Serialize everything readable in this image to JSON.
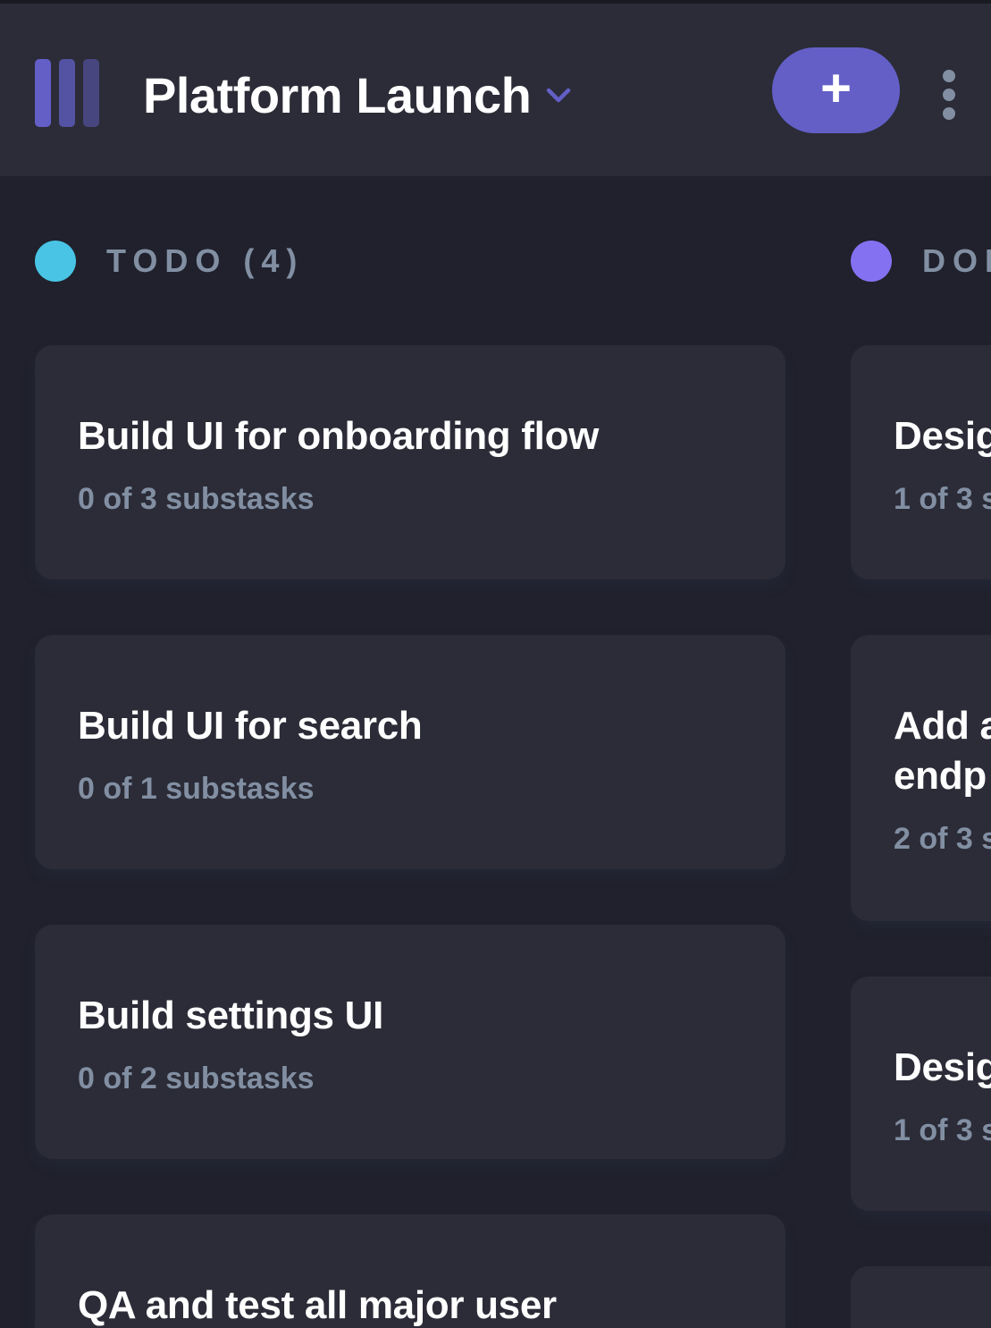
{
  "header": {
    "board_title": "Platform Launch",
    "add_task_label": "+",
    "icons": [
      "board-logo-icon",
      "chevron-down-icon",
      "plus-icon",
      "vertical-ellipsis-icon"
    ]
  },
  "columns": [
    {
      "label": "TODO (4)",
      "color": "#49c4e5",
      "tasks": [
        {
          "title": "Build UI for onboarding flow",
          "subtasks": "0 of 3 substasks"
        },
        {
          "title": "Build UI for search",
          "subtasks": "0 of 1 substasks"
        },
        {
          "title": "Build settings UI",
          "subtasks": "0 of 2 substasks"
        },
        {
          "title": "QA and test all major user",
          "subtasks": ""
        }
      ]
    },
    {
      "label": "DOI",
      "color": "#8471f2",
      "tasks": [
        {
          "title": "Desig",
          "subtasks": "1 of 3 s"
        },
        {
          "title_line1": "Add a",
          "title_line2": "endp",
          "subtasks": "2 of 3 s"
        },
        {
          "title": "Desig",
          "subtasks": "1 of 3 s"
        }
      ]
    }
  ],
  "colors": {
    "accent": "#635fc7",
    "background": "#20212c",
    "surface": "#2b2c37",
    "muted_text": "#828fa3"
  }
}
